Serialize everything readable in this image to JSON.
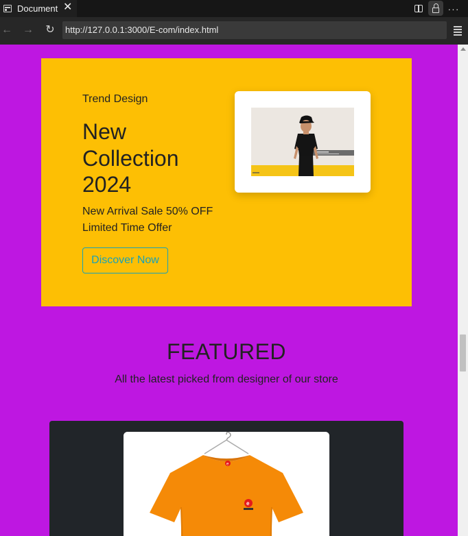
{
  "browser": {
    "tab_title": "Document",
    "tab_close": "✕",
    "url": "http://127.0.0.1:3000/E-com/index.html",
    "icons": [
      "document-icon",
      "close-icon",
      "split-view-icon",
      "lock-icon",
      "more-icon",
      "back-icon",
      "forward-icon",
      "reload-icon",
      "menu-icon"
    ]
  },
  "hero": {
    "kicker": "Trend Design",
    "title": "New Collection 2024",
    "subtitle": "New Arrival Sale 50% OFF Limited Time Offer",
    "button_label": "Discover Now",
    "background": "#fdbf04",
    "button_color": "#17a2b8"
  },
  "featured": {
    "title": "FEATURED",
    "subtitle": "All the latest picked from designer of our store"
  },
  "colors": {
    "page_background": "#be17e1",
    "card_background": "#212529",
    "tshirt": "#f58a07"
  }
}
